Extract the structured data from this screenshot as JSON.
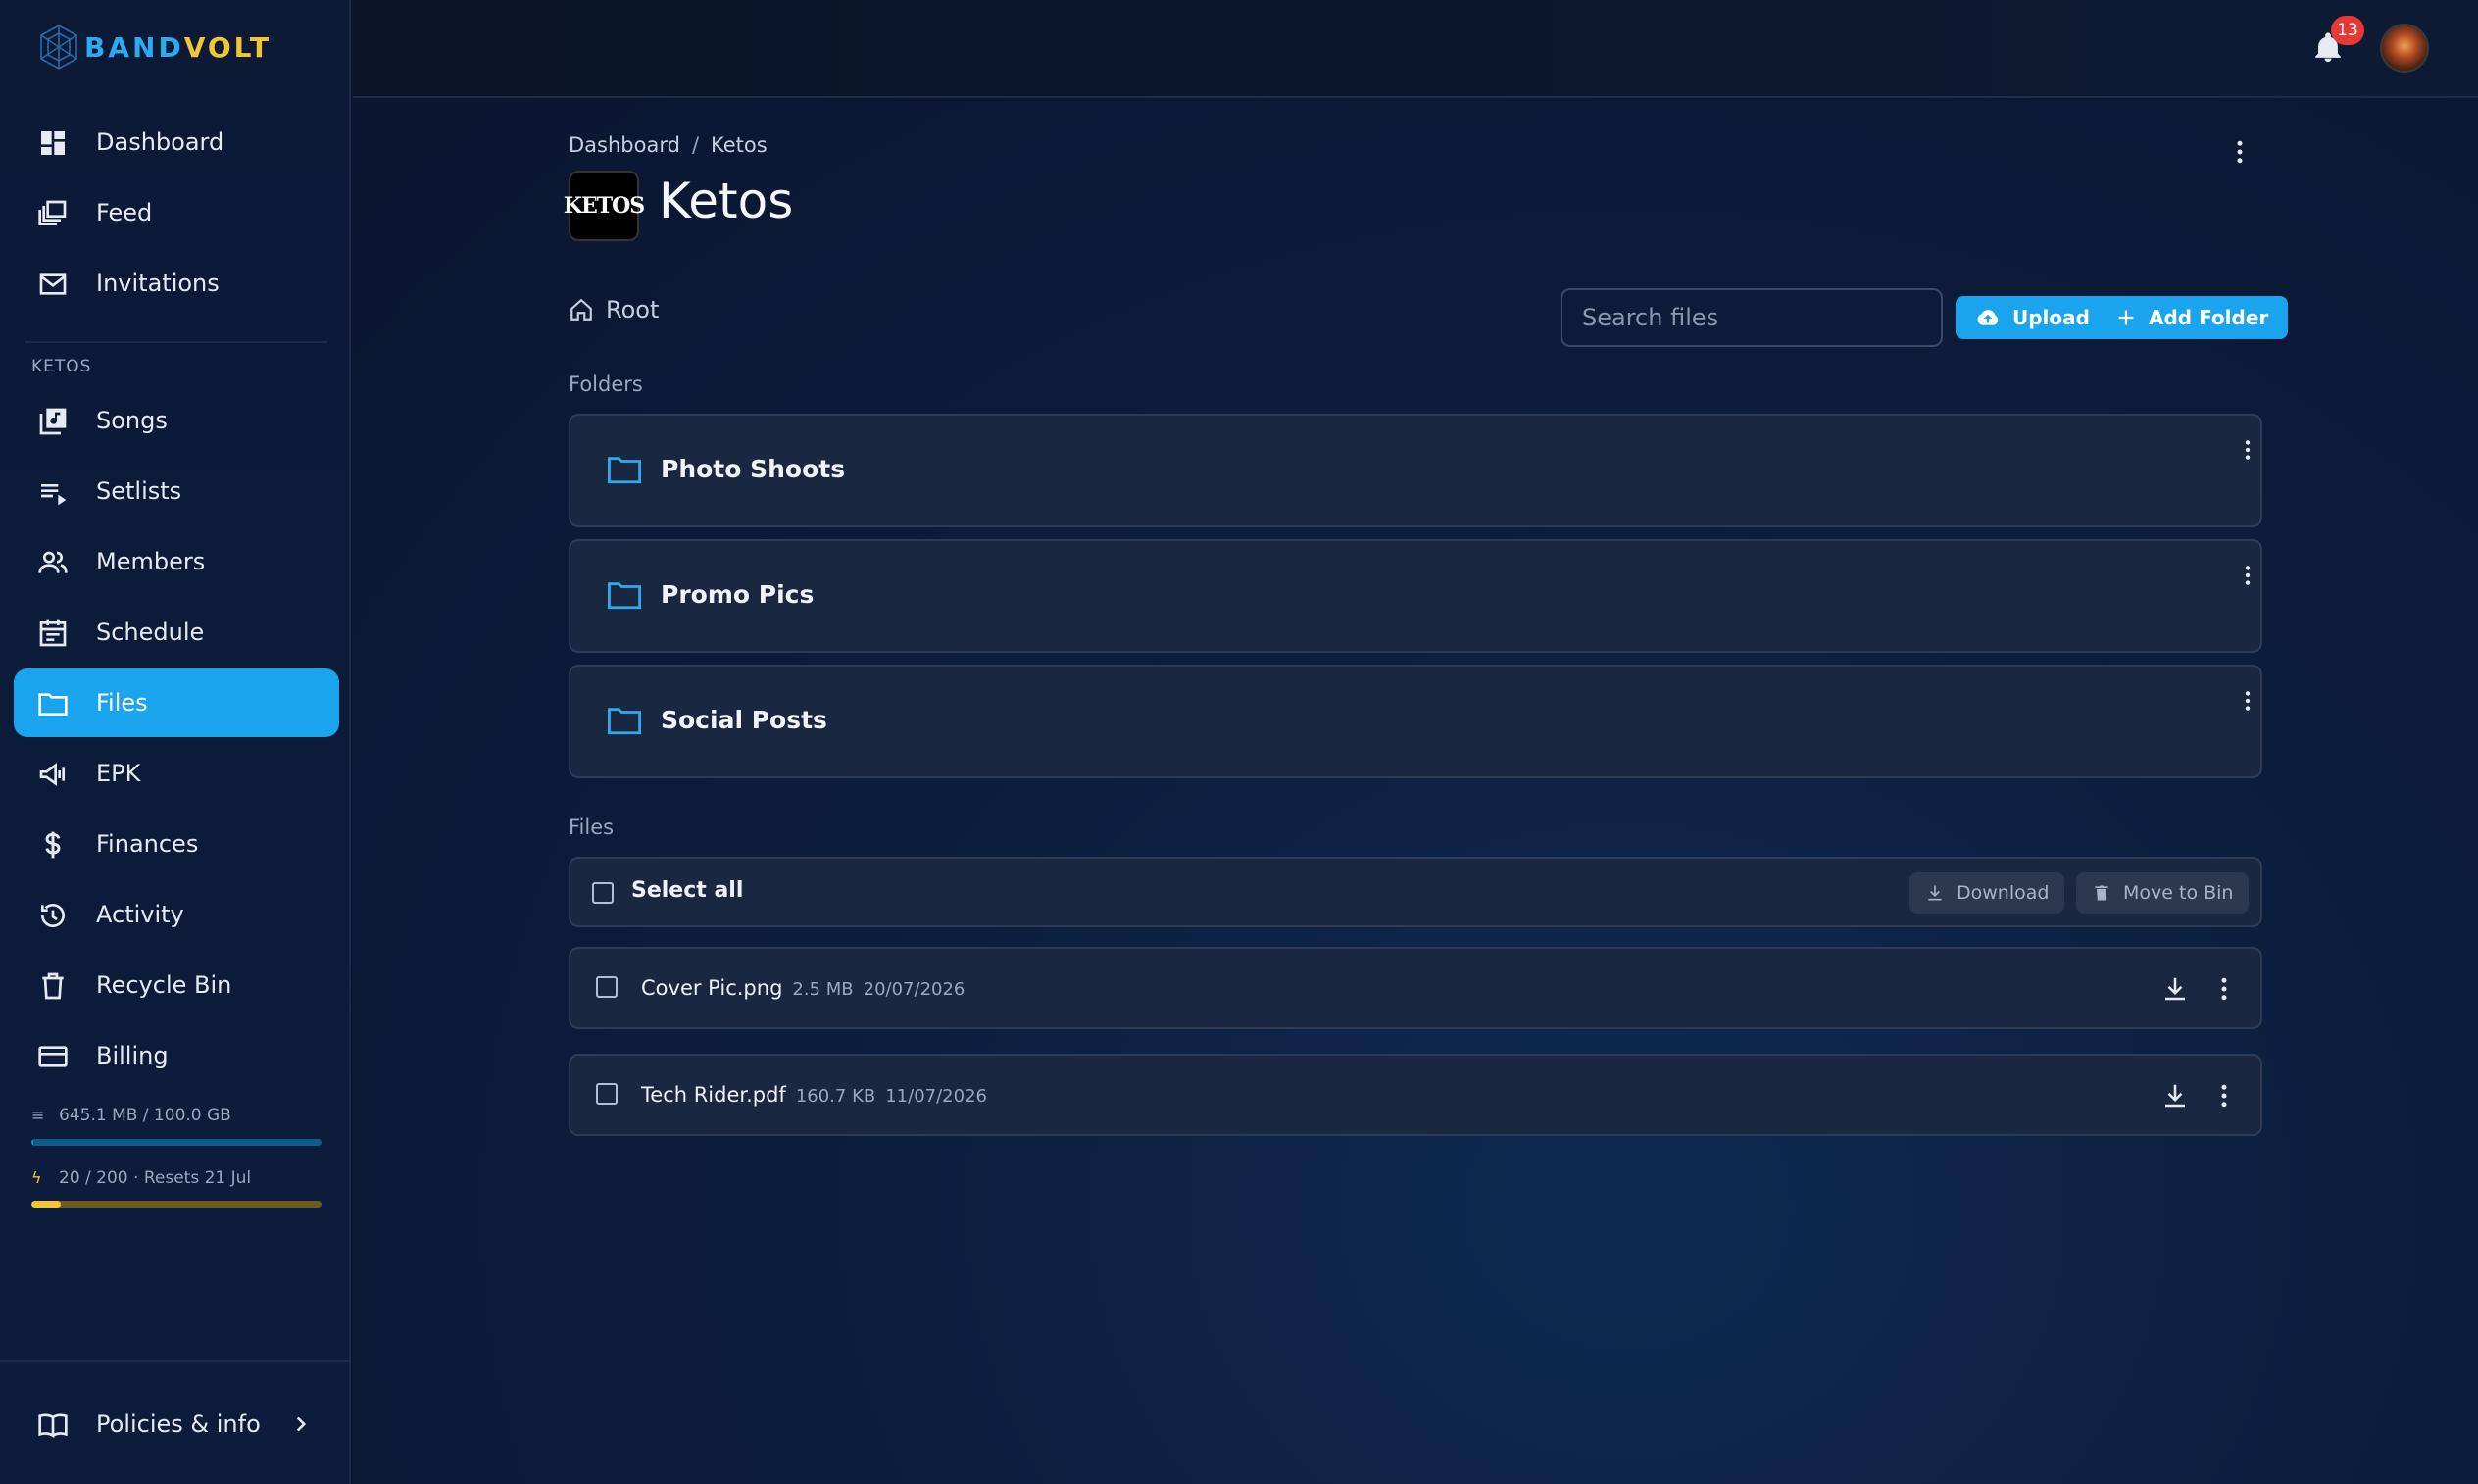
{
  "brand": {
    "part1": "BAND",
    "part2": "VOLT"
  },
  "nav": {
    "top": [
      {
        "label": "Dashboard",
        "icon": "dashboard-icon"
      },
      {
        "label": "Feed",
        "icon": "feed-icon"
      },
      {
        "label": "Invitations",
        "icon": "mail-icon"
      }
    ],
    "section_label": "KETOS",
    "band": [
      {
        "label": "Songs",
        "icon": "music-library-icon"
      },
      {
        "label": "Setlists",
        "icon": "playlist-icon"
      },
      {
        "label": "Members",
        "icon": "people-icon"
      },
      {
        "label": "Schedule",
        "icon": "calendar-icon"
      },
      {
        "label": "Files",
        "icon": "folder-icon",
        "active": true
      },
      {
        "label": "EPK",
        "icon": "megaphone-icon"
      },
      {
        "label": "Finances",
        "icon": "dollar-icon"
      },
      {
        "label": "Activity",
        "icon": "history-icon"
      },
      {
        "label": "Recycle Bin",
        "icon": "trash-icon"
      },
      {
        "label": "Billing",
        "icon": "credit-card-icon"
      }
    ],
    "storage": {
      "text": "645.1 MB / 100.0 GB",
      "fraction": 0.0063,
      "color": "#1e86c9"
    },
    "credits": {
      "text": "20 / 200 · Resets 21 Jul",
      "fraction": 0.1,
      "color": "#f2c534"
    },
    "policies_label": "Policies & info"
  },
  "topbar": {
    "notifications_count": "13"
  },
  "page": {
    "breadcrumb": {
      "parent": "Dashboard",
      "sep": "/",
      "current": "Ketos"
    },
    "band_logo_text": "KETOS",
    "title": "Ketos",
    "root_label": "Root",
    "search_placeholder": "Search files",
    "upload_label": "Upload",
    "add_folder_label": "Add Folder",
    "folders_label": "Folders",
    "folders": [
      {
        "name": "Photo Shoots"
      },
      {
        "name": "Promo Pics"
      },
      {
        "name": "Social Posts"
      }
    ],
    "files_label": "Files",
    "select_all_label": "Select all",
    "download_label": "Download",
    "move_to_bin_label": "Move to Bin",
    "files": [
      {
        "name": "Cover Pic.png",
        "size": "2.5 MB",
        "date": "20/07/2026"
      },
      {
        "name": "Tech Rider.pdf",
        "size": "160.7 KB",
        "date": "11/07/2026"
      }
    ]
  },
  "colors": {
    "accent": "#1ba4ee",
    "badge": "#e53935",
    "folder_icon": "#2eaaf0"
  }
}
